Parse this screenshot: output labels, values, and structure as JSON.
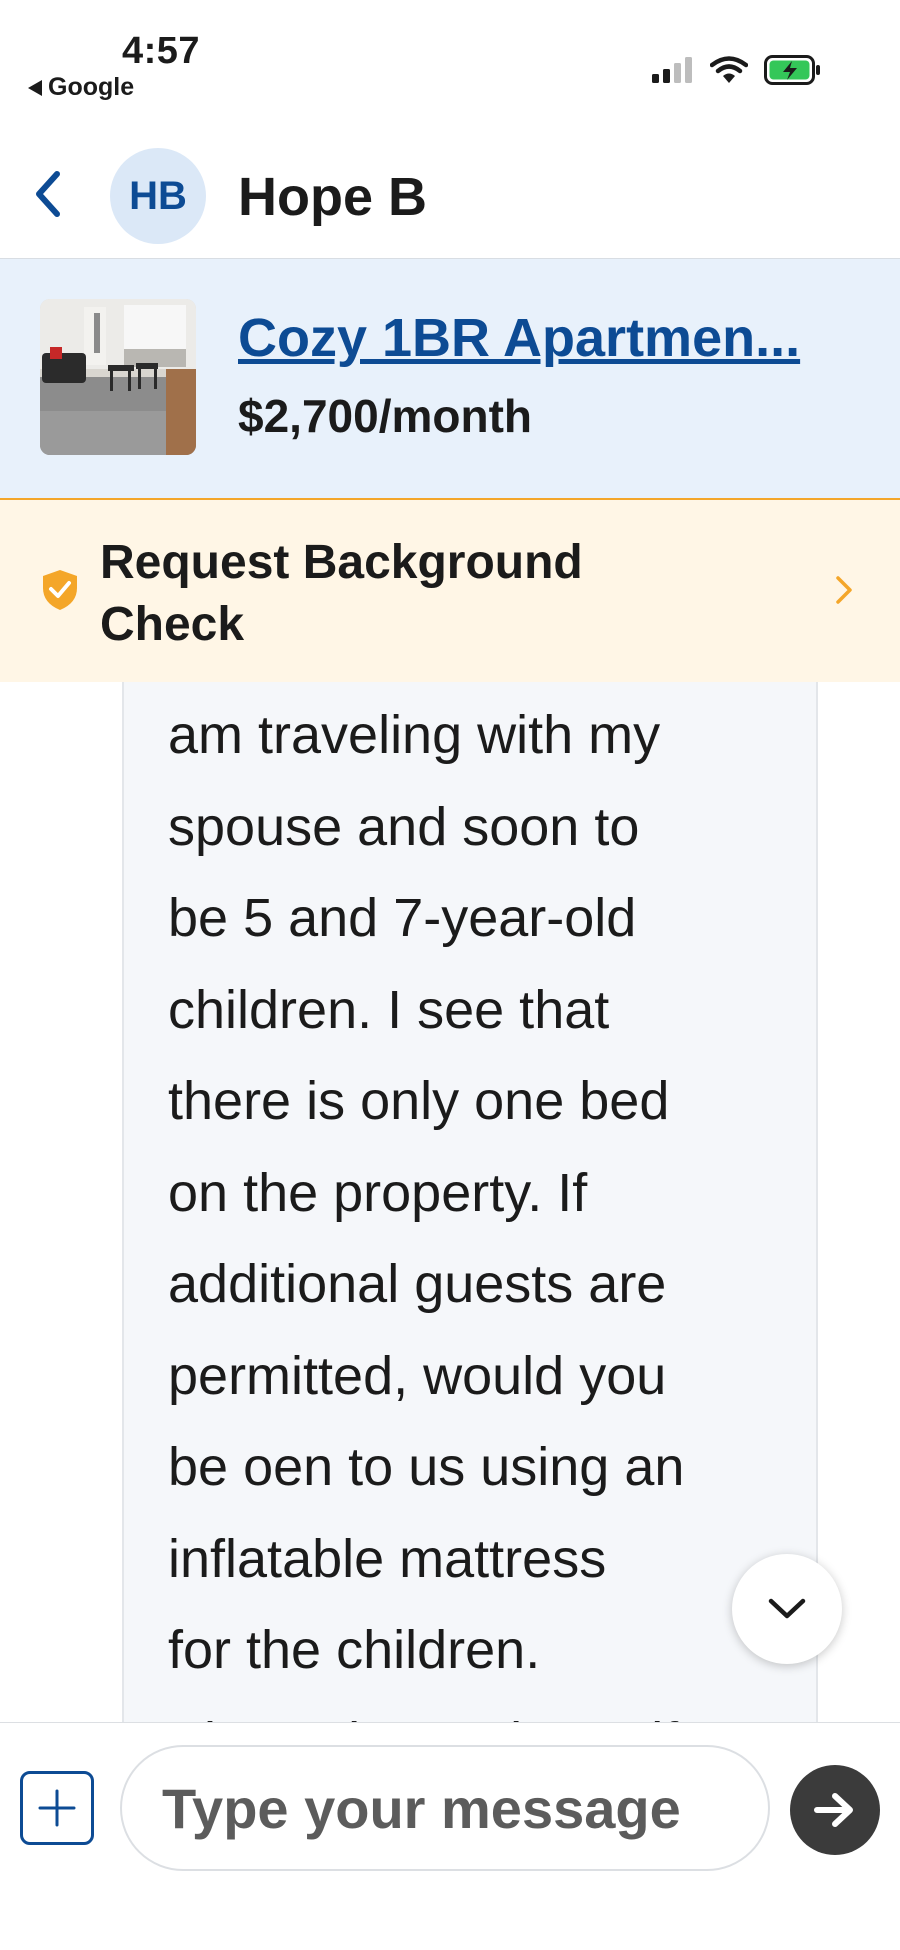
{
  "status_bar": {
    "time": "4:57",
    "back_app": "Google"
  },
  "header": {
    "avatar_initials": "HB",
    "contact_name": "Hope B"
  },
  "listing": {
    "title": "Cozy 1BR Apartmen...",
    "price": "$2,700/month"
  },
  "background_check": {
    "label": "Request Background Check"
  },
  "message": {
    "text": "am traveling with my\nspouse and soon to\nbe 5 and 7-year-old\nchildren. I see that\nthere is only one bed\non the property. If\nadditional guests are\npermitted, would you\nbe oen to us using an\ninflatable mattress\nfor the children.\nPlease let me know if"
  },
  "composer": {
    "placeholder": "Type your message"
  },
  "colors": {
    "brand_blue": "#0d4b94",
    "avatar_bg": "#dbe8f7",
    "listing_bg": "#e8f1fb",
    "banner_bg": "#fff6e6",
    "banner_border": "#f4a629",
    "battery_green": "#34c759",
    "send_button": "#3b3b3b"
  },
  "icons": {
    "back": "chevron-left-icon",
    "shield": "shield-check-icon",
    "banner_chevron": "chevron-right-icon",
    "scroll_down": "chevron-down-icon",
    "add": "plus-icon",
    "send": "arrow-right-icon",
    "signal": "cellular-signal-icon",
    "wifi": "wifi-icon",
    "battery": "battery-charging-icon"
  }
}
